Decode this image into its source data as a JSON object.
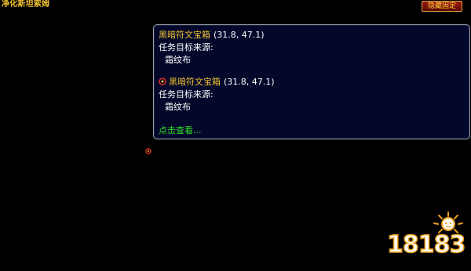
{
  "zone": {
    "title": "净化斯坦索姆"
  },
  "controls": {
    "hide_pin_label": "隐藏固定"
  },
  "tooltip": {
    "entries": [
      {
        "name": "黑暗符文宝箱",
        "coords": "(31.8, 47.1)",
        "source_label": "任务目标来源:",
        "source_item": "霜纹布",
        "icon": "pin-icon"
      },
      {
        "name": "黑暗符文宝箱",
        "coords": "(31.8, 47.1)",
        "source_label": "任务目标来源:",
        "source_item": "霜纹布",
        "icon": "red-target-pin-icon"
      }
    ],
    "link_label": "点击查看..."
  },
  "map": {
    "marker_icon": "red-target-pin-icon"
  },
  "watermark": {
    "text": "18183"
  },
  "colors": {
    "background": "#000000",
    "tooltip_bg": "#03082a",
    "gold_text": "#f2c230",
    "link_green": "#33e02a",
    "button_red": "#9c1a10"
  }
}
